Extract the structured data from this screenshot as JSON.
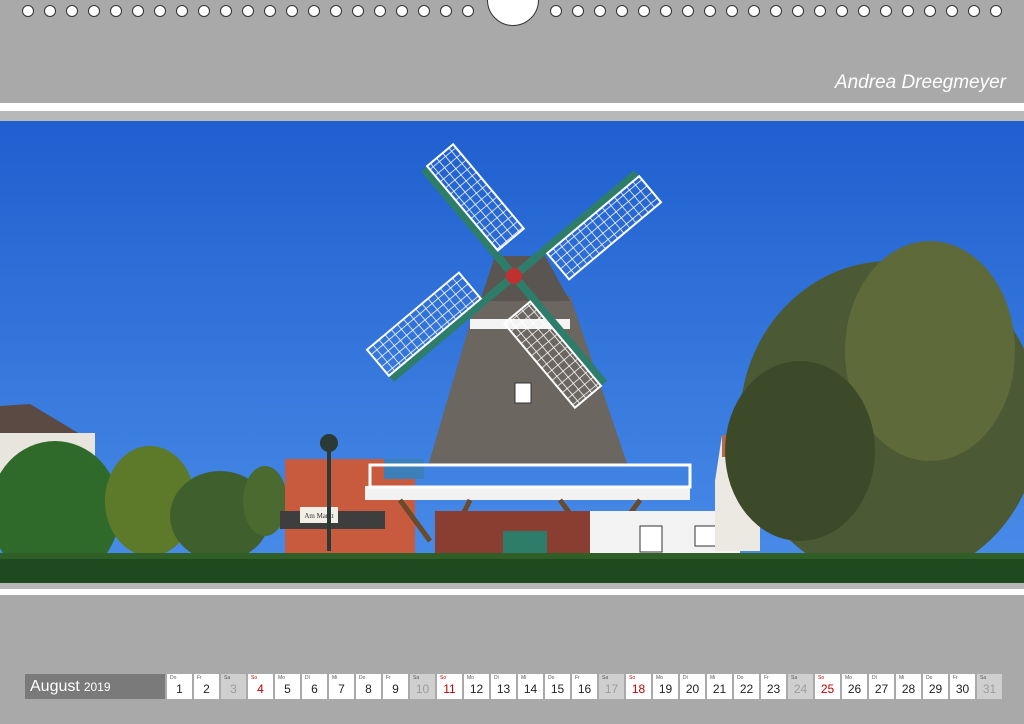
{
  "header": {
    "author": "Andrea Dreegmeyer"
  },
  "photo": {
    "sign_text": "Am Markt"
  },
  "calendar": {
    "month": "August",
    "year": "2019",
    "days": [
      {
        "wd": "Do",
        "num": "1",
        "type": "weekday"
      },
      {
        "wd": "Fr",
        "num": "2",
        "type": "weekday"
      },
      {
        "wd": "Sa",
        "num": "3",
        "type": "weekend"
      },
      {
        "wd": "So",
        "num": "4",
        "type": "sunday"
      },
      {
        "wd": "Mo",
        "num": "5",
        "type": "weekday"
      },
      {
        "wd": "Di",
        "num": "6",
        "type": "weekday"
      },
      {
        "wd": "Mi",
        "num": "7",
        "type": "weekday"
      },
      {
        "wd": "Do",
        "num": "8",
        "type": "weekday"
      },
      {
        "wd": "Fr",
        "num": "9",
        "type": "weekday"
      },
      {
        "wd": "Sa",
        "num": "10",
        "type": "weekend"
      },
      {
        "wd": "So",
        "num": "11",
        "type": "sunday"
      },
      {
        "wd": "Mo",
        "num": "12",
        "type": "weekday"
      },
      {
        "wd": "Di",
        "num": "13",
        "type": "weekday"
      },
      {
        "wd": "Mi",
        "num": "14",
        "type": "weekday"
      },
      {
        "wd": "Do",
        "num": "15",
        "type": "weekday"
      },
      {
        "wd": "Fr",
        "num": "16",
        "type": "weekday"
      },
      {
        "wd": "Sa",
        "num": "17",
        "type": "weekend"
      },
      {
        "wd": "So",
        "num": "18",
        "type": "sunday"
      },
      {
        "wd": "Mo",
        "num": "19",
        "type": "weekday"
      },
      {
        "wd": "Di",
        "num": "20",
        "type": "weekday"
      },
      {
        "wd": "Mi",
        "num": "21",
        "type": "weekday"
      },
      {
        "wd": "Do",
        "num": "22",
        "type": "weekday"
      },
      {
        "wd": "Fr",
        "num": "23",
        "type": "weekday"
      },
      {
        "wd": "Sa",
        "num": "24",
        "type": "weekend"
      },
      {
        "wd": "So",
        "num": "25",
        "type": "sunday"
      },
      {
        "wd": "Mo",
        "num": "26",
        "type": "weekday"
      },
      {
        "wd": "Di",
        "num": "27",
        "type": "weekday"
      },
      {
        "wd": "Mi",
        "num": "28",
        "type": "weekday"
      },
      {
        "wd": "Do",
        "num": "29",
        "type": "weekday"
      },
      {
        "wd": "Fr",
        "num": "30",
        "type": "weekday"
      },
      {
        "wd": "Sa",
        "num": "31",
        "type": "weekend"
      }
    ]
  },
  "colors": {
    "background": "#a9a9a9",
    "sky": "#2f6fd6",
    "sunday_red": "#c00000",
    "sail_green": "#2e7d6b"
  }
}
